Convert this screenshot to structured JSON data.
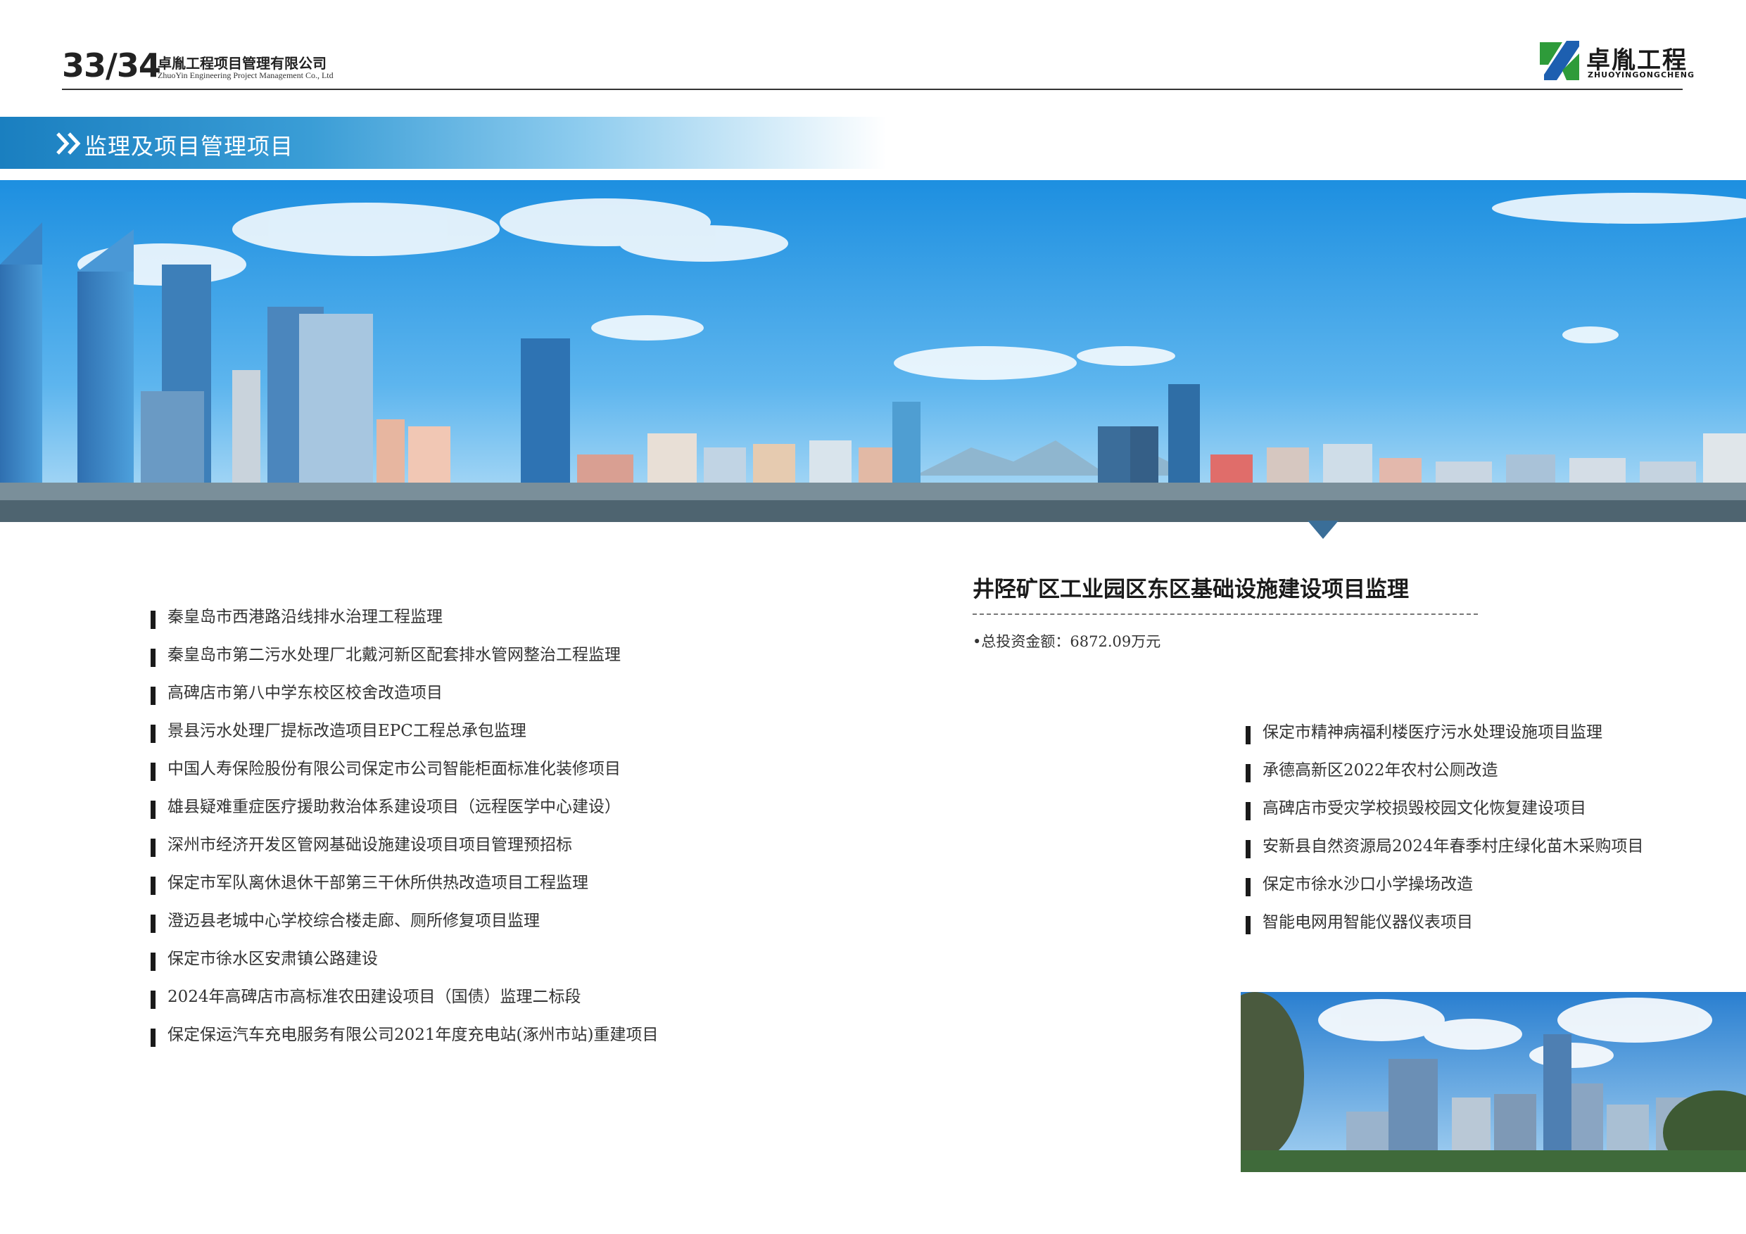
{
  "header": {
    "page_number": "33/34",
    "company_cn": "卓胤工程项目管理有限公司",
    "company_en": "ZhuoYin Engineering Project Management Co., Ltd",
    "logo_cn": "卓胤工程",
    "logo_en": "ZHUOYINGONGCHENG"
  },
  "section": {
    "title": "监理及项目管理项目"
  },
  "featured": {
    "title": "井陉矿区工业园区东区基础设施建设项目监理",
    "investment": "•总投资金额：6872.09万元"
  },
  "left_projects": [
    "秦皇岛市西港路沿线排水治理工程监理",
    "秦皇岛市第二污水处理厂北戴河新区配套排水管网整治工程监理",
    "高碑店市第八中学东校区校舍改造项目",
    "景县污水处理厂提标改造项目EPC工程总承包监理",
    "中国人寿保险股份有限公司保定市公司智能柜面标准化装修项目",
    "雄县疑难重症医疗援助救治体系建设项目（远程医学中心建设）",
    "深州市经济开发区管网基础设施建设项目项目管理预招标",
    "保定市军队离休退休干部第三干休所供热改造项目工程监理",
    "澄迈县老城中心学校综合楼走廊、厕所修复项目监理",
    "保定市徐水区安肃镇公路建设",
    "2024年高碑店市高标准农田建设项目（国债）监理二标段",
    "保定保运汽车充电服务有限公司2021年度充电站(涿州市站)重建项目"
  ],
  "right_projects": [
    "保定市精神病福利楼医疗污水处理设施项目监理",
    "承德高新区2022年农村公厕改造",
    "高碑店市受灾学校损毁校园文化恢复建设项目",
    "安新县自然资源局2024年春季村庄绿化苗木采购项目",
    "保定市徐水沙口小学操场改造",
    "智能电网用智能仪器仪表项目"
  ],
  "colors": {
    "brand_blue": "#1a7fc0",
    "logo_green": "#2e9b3a",
    "logo_blue": "#1d5fb0",
    "text": "#333333"
  }
}
